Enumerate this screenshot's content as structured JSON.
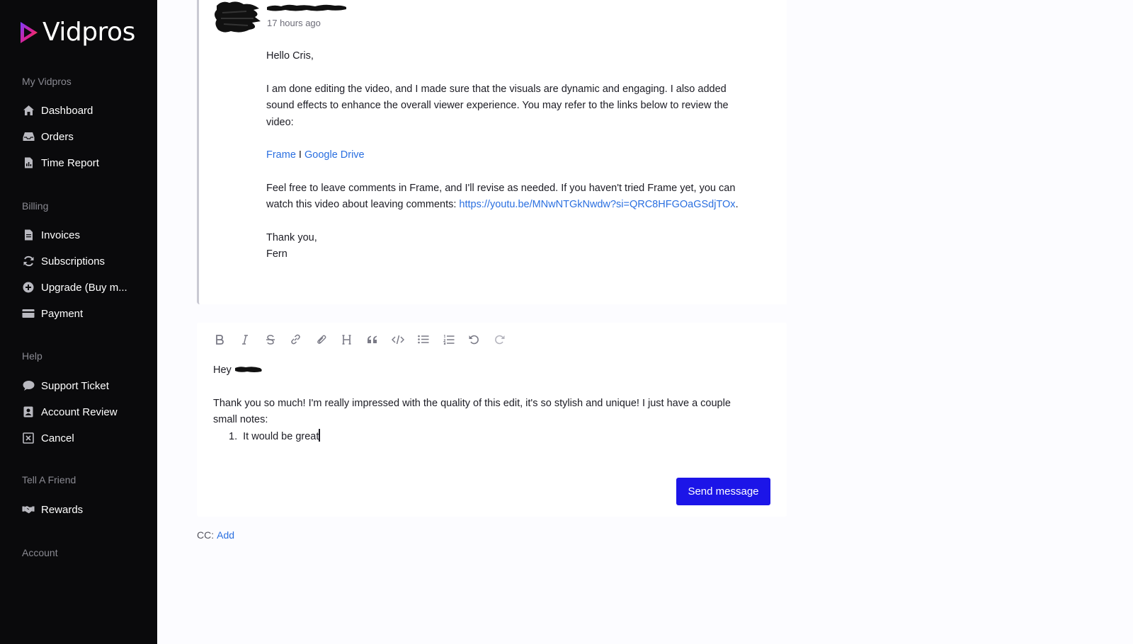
{
  "brand": {
    "name": "Vidpros"
  },
  "sidebar": {
    "sections": [
      {
        "title": "My Vidpros",
        "items": [
          {
            "label": "Dashboard",
            "icon": "home-icon"
          },
          {
            "label": "Orders",
            "icon": "inbox-icon"
          },
          {
            "label": "Time Report",
            "icon": "report-icon"
          }
        ]
      },
      {
        "title": "Billing",
        "items": [
          {
            "label": "Invoices",
            "icon": "file-icon"
          },
          {
            "label": "Subscriptions",
            "icon": "refresh-icon"
          },
          {
            "label": "Upgrade (Buy m...",
            "icon": "plus-circle-icon"
          },
          {
            "label": "Payment",
            "icon": "credit-card-icon"
          }
        ]
      },
      {
        "title": "Help",
        "items": [
          {
            "label": "Support Ticket",
            "icon": "chat-icon"
          },
          {
            "label": "Account Review",
            "icon": "account-icon"
          },
          {
            "label": "Cancel",
            "icon": "x-square-icon"
          }
        ]
      },
      {
        "title": "Tell A Friend",
        "items": [
          {
            "label": "Rewards",
            "icon": "handshake-icon"
          }
        ]
      },
      {
        "title": "Account",
        "items": []
      }
    ]
  },
  "message": {
    "timestamp": "17 hours ago",
    "greeting": "Hello Cris,",
    "paragraph1": "I am done editing the video, and I made sure that the visuals are dynamic and engaging. I also added sound effects to enhance the overall viewer experience. You may refer to the links below to review the video:",
    "link_frame": "Frame",
    "link_separator": " I ",
    "link_drive": "Google Drive",
    "paragraph3_text": "Feel free to leave comments in Frame, and I'll revise as needed. If you haven't tried Frame yet, you can watch this video about leaving comments: ",
    "paragraph3_link": "https://youtu.be/MNwNTGkNwdw?si=QRC8HFGOaGSdjTOx",
    "paragraph3_end": ".",
    "signoff": "Thank you,",
    "signature": "Fern"
  },
  "composer": {
    "toolbar": [
      "bold-icon",
      "italic-icon",
      "strikethrough-icon",
      "link-icon",
      "attachment-icon",
      "heading-icon",
      "quote-icon",
      "code-icon",
      "bullet-list-icon",
      "numbered-list-icon",
      "undo-icon",
      "redo-icon"
    ],
    "greeting": "Hey",
    "paragraph": "Thank you so much! I'm really impressed with the quality of this edit, it's so stylish and unique! I just have a couple small notes:",
    "list_number": "1.",
    "list_item": "It would be great",
    "send_label": "Send message"
  },
  "cc": {
    "label": "CC:",
    "add_label": "Add"
  },
  "colors": {
    "sidebar_bg": "#0a0a0c",
    "accent": "#1c15e8",
    "link": "#2a6fe0"
  }
}
